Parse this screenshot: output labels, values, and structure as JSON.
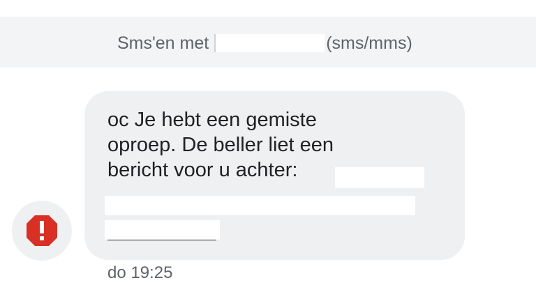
{
  "header": {
    "title_prefix": "Sms'en met",
    "title_suffix": "(sms/mms)"
  },
  "message": {
    "lines": [
      "oc Je hebt een gemiste",
      "oproep. De beller liet een",
      "bericht voor u achter:"
    ],
    "timestamp": "do 19:25"
  },
  "icons": {
    "alert": "error-octagon-icon"
  },
  "colors": {
    "alert_red": "#d93025",
    "bubble_bg": "#eff0f2",
    "header_bg": "#f3f4f6"
  }
}
